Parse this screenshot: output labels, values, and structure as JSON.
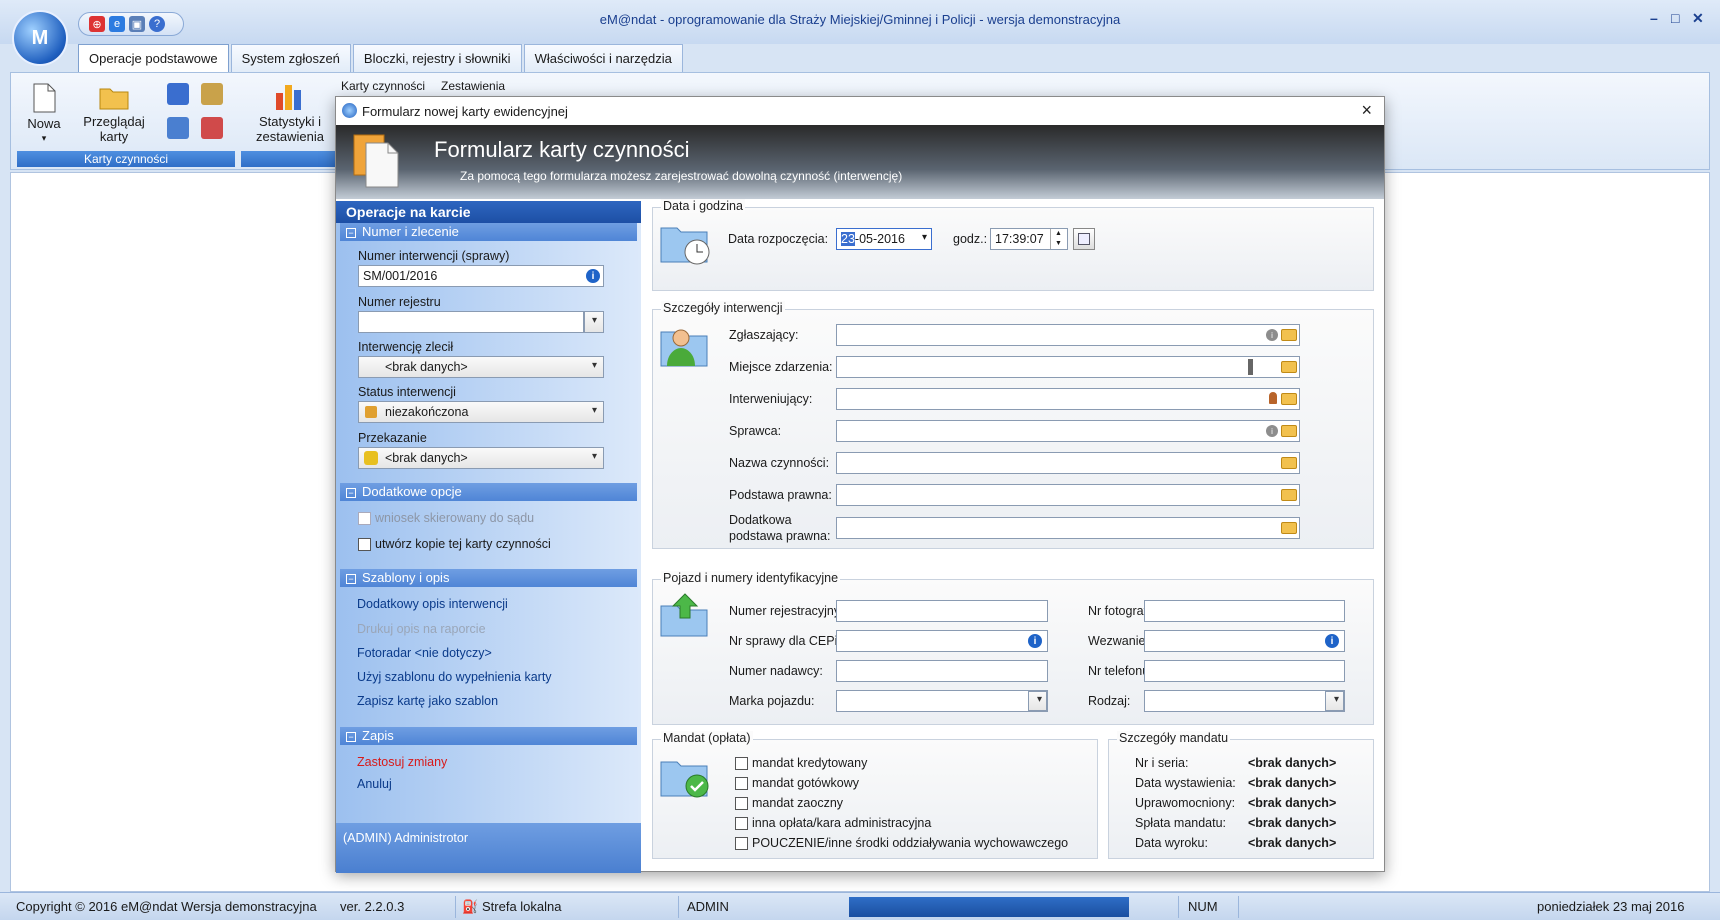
{
  "app": {
    "title": "eM@ndat - oprogramowanie dla Straży Miejskiej/Gminnej i Policji - wersja demonstracyjna",
    "logo_text": "M",
    "window_controls": [
      "–",
      "□",
      "✕"
    ]
  },
  "tabs": [
    "Operacje podstawowe",
    "System zgłoszeń",
    "Bloczki, rejestry i słowniki",
    "Właściwości i narzędzia"
  ],
  "ribbon": {
    "new_label": "Nowa",
    "browse_label_1": "Przeglądaj",
    "browse_label_2": "karty",
    "stats_label_1": "Statystyki i",
    "stats_label_2": "zestawienia",
    "group_label": "Karty czynności",
    "hidden_1": "Karty czynności",
    "hidden_2": "Zestawienia"
  },
  "status": {
    "copyright": "Copyright © 2016 eM@ndat  Wersja demonstracyjna",
    "version": "ver. 2.2.0.3",
    "zone": "Strefa lokalna",
    "user": "ADMIN",
    "num": "NUM",
    "date": "poniedziałek 23 maj 2016"
  },
  "dialog": {
    "title": "Formularz nowej karty ewidencyjnej",
    "close": "×",
    "header_title": "Formularz karty czynności",
    "header_sub": "Za pomocą tego formularza możesz zarejestrować dowolną czynność (interwencję)"
  },
  "left": {
    "head": "Operacje na karcie",
    "sec_number": "Numer i zlecenie",
    "int_number_label": "Numer interwencji (sprawy)",
    "int_number_value": "SM/001/2016",
    "register_label": "Numer rejestru",
    "ordered_label": "Interwencję zlecił",
    "ordered_value": "<brak danych>",
    "status_label": "Status interwencji",
    "status_value": "niezakończona",
    "transfer_label": "Przekazanie",
    "transfer_value": "<brak danych>",
    "sec_extra": "Dodatkowe opcje",
    "cb_court": "wniosek skierowany do sądu",
    "cb_copy": "utwórz kopie tej karty czynności",
    "sec_templates": "Szablony i opis",
    "link_desc": "Dodatkowy opis interwencji",
    "link_print": "Drukuj opis na raporcie",
    "link_foto": "Fotoradar <nie dotyczy>",
    "link_use": "Użyj szablonu do wypełnienia karty",
    "link_save_tpl": "Zapisz kartę jako szablon",
    "sec_save": "Zapis",
    "link_apply": "Zastosuj zmiany",
    "link_cancel": "Anuluj",
    "footer": "(ADMIN) Administrotor"
  },
  "datetime": {
    "group": "Data i godzina",
    "start_label": "Data rozpoczęcia:",
    "start_sel": "23",
    "start_value": "-05-2016",
    "time_label": "godz.:",
    "time_value": "17:39:07"
  },
  "details": {
    "group": "Szczegóły interwencji",
    "fields": [
      "Zgłaszający:",
      "Miejsce zdarzenia:",
      "Interweniujący:",
      "Sprawca:",
      "Nazwa czynności:",
      "Podstawa prawna:"
    ],
    "extra_label_1": "Dodatkowa",
    "extra_label_2": "podstawa prawna:"
  },
  "vehicle": {
    "group": "Pojazd i numery identyfikacyjne",
    "reg": "Numer rejestracyjny:",
    "cepik": "Nr sprawy dla CEPiK:",
    "sender": "Numer nadawcy:",
    "brand": "Marka pojazdu:",
    "photo": "Nr fotografii:",
    "summons": "Wezwanie:",
    "phone": "Nr telefonu:",
    "kind": "Rodzaj:"
  },
  "fine": {
    "group": "Mandat (opłata)",
    "options": [
      "mandat kredytowany",
      "mandat gotówkowy",
      "mandat zaoczny",
      "inna opłata/kara administracyjna",
      "POUCZENIE/inne środki oddziaływania wychowawczego"
    ]
  },
  "fine_details": {
    "group": "Szczegóły mandatu",
    "rows": [
      {
        "label": "Nr i seria:",
        "value": "<brak danych>"
      },
      {
        "label": "Data wystawienia:",
        "value": "<brak danych>"
      },
      {
        "label": "Uprawomocniony:",
        "value": "<brak danych>"
      },
      {
        "label": "Spłata mandatu:",
        "value": "<brak danych>"
      },
      {
        "label": "Data wyroku:",
        "value": "<brak danych>"
      }
    ]
  },
  "colors": {
    "accent": "#2f6ec7",
    "link": "#0a3a8a",
    "danger": "#d81a1a"
  }
}
